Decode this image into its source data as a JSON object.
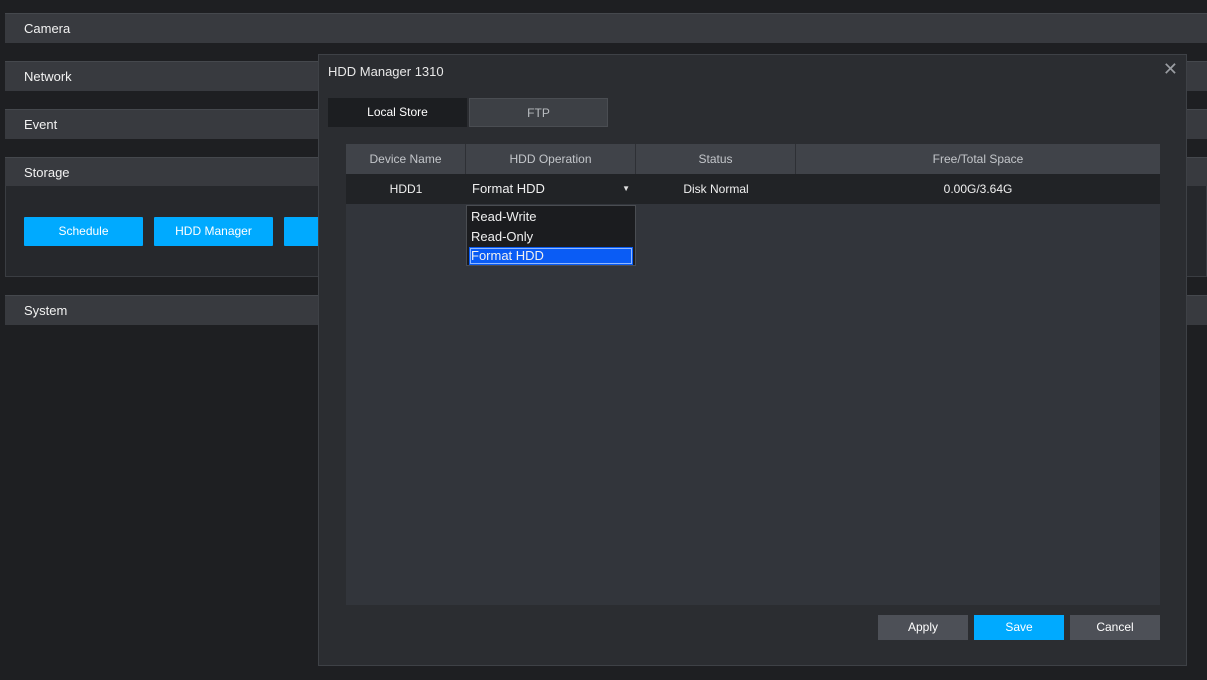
{
  "sections": {
    "camera": "Camera",
    "network": "Network",
    "event": "Event",
    "storage": "Storage",
    "system": "System"
  },
  "storage_buttons": {
    "schedule": "Schedule",
    "hdd_manager": "HDD Manager"
  },
  "dialog": {
    "title": "HDD Manager 1310",
    "close": "✕",
    "tabs": [
      "Local Store",
      "FTP"
    ],
    "active_tab": "Local Store",
    "table": {
      "headers": [
        "Device Name",
        "HDD Operation",
        "Status",
        "Free/Total Space"
      ],
      "rows": [
        {
          "device": "HDD1",
          "operation": "Format HDD",
          "status": "Disk Normal",
          "space": "0.00G/3.64G"
        }
      ]
    },
    "operation_options": [
      "Read-Write",
      "Read-Only",
      "Format HDD"
    ],
    "selected_option": "Format HDD",
    "buttons": {
      "apply": "Apply",
      "save": "Save",
      "cancel": "Cancel"
    }
  },
  "colors": {
    "accent": "#00aaff",
    "selection": "#0a5cf5"
  }
}
